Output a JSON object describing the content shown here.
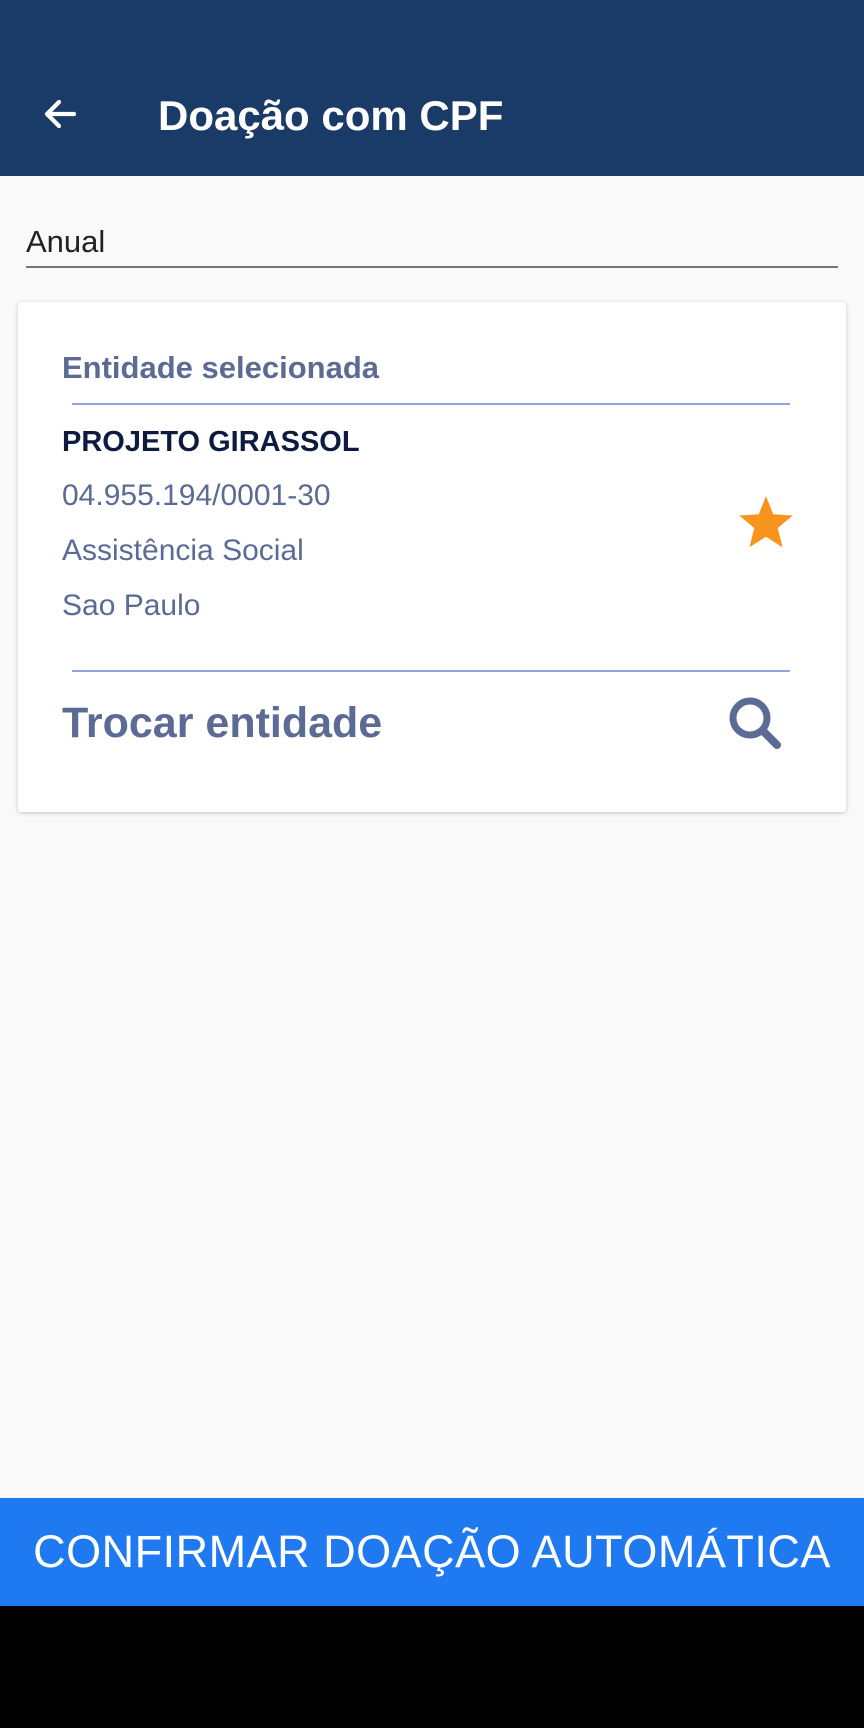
{
  "app_bar": {
    "title": "Doação com CPF",
    "back_icon": "arrow-left-icon"
  },
  "period_select": {
    "value": "Anual"
  },
  "entity_card": {
    "heading": "Entidade selecionada",
    "name": "PROJETO GIRASSOL",
    "cnpj": "04.955.194/0001-30",
    "category": "Assistência Social",
    "city": "Sao Paulo",
    "favorite_icon": "star-icon",
    "change_label": "Trocar entidade",
    "change_icon": "search-icon"
  },
  "footer": {
    "confirm_label": "CONFIRMAR DOAÇÃO AUTOMÁTICA"
  },
  "colors": {
    "app_bar": "#1a3b68",
    "accent_text": "#5b6b94",
    "star": "#f7941d",
    "confirm_button": "#1f7af2"
  }
}
